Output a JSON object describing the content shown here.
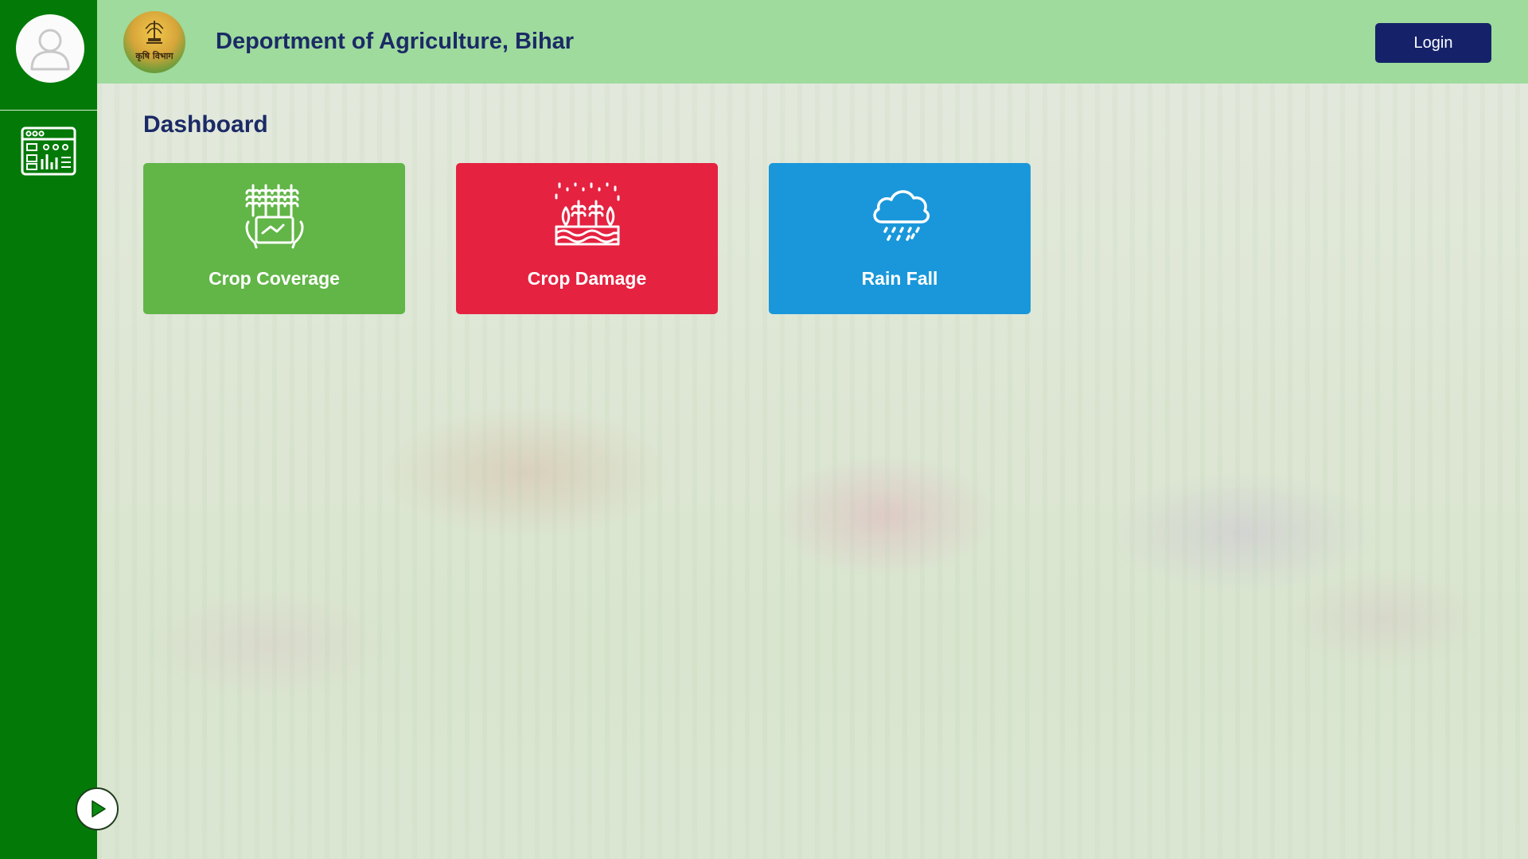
{
  "header": {
    "title": "Deportment of Agriculture, Bihar",
    "logo_text": "कृषि विभाग",
    "login_label": "Login"
  },
  "sidebar": {
    "items": [
      {
        "name": "dashboard",
        "icon": "dashboard-icon"
      }
    ],
    "avatar_icon": "user-icon",
    "play_icon": "play-icon"
  },
  "main": {
    "heading": "Dashboard",
    "cards": [
      {
        "label": "Crop Coverage",
        "icon": "crop-coverage-icon",
        "color": "#62b547"
      },
      {
        "label": "Crop Damage",
        "icon": "crop-damage-icon",
        "color": "#e52240"
      },
      {
        "label": "Rain Fall",
        "icon": "rain-cloud-icon",
        "color": "#1a97da"
      }
    ]
  },
  "colors": {
    "sidebar": "#037a07",
    "header": "#9edb9c",
    "title_text": "#1b2a66",
    "login_button": "#15226a"
  }
}
